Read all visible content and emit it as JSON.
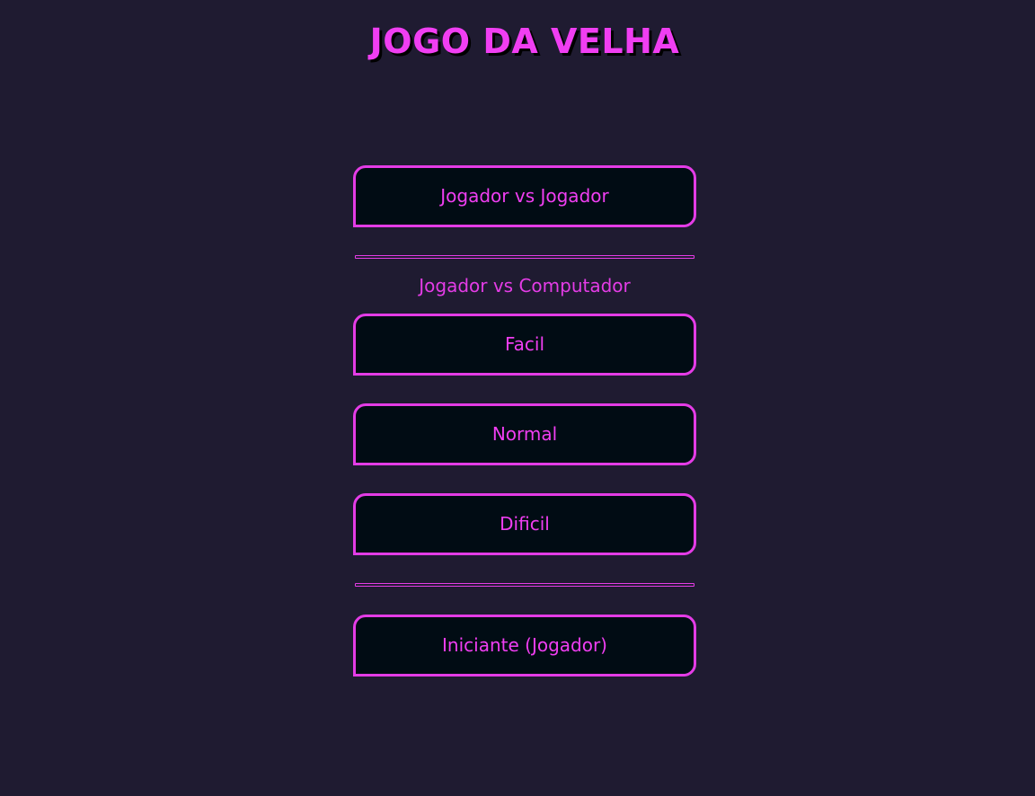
{
  "header": {
    "title": "JOGO DA VELHA"
  },
  "menu": {
    "pvp_label": "Jogador vs Jogador",
    "pvc_section_label": "Jogador vs Computador",
    "easy_label": "Facil",
    "normal_label": "Normal",
    "hard_label": "Dificil",
    "starter_label": "Iniciante (Jogador)"
  },
  "colors": {
    "background": "#1f1b31",
    "accent": "#f03ef2",
    "button_fill": "#010c14"
  }
}
